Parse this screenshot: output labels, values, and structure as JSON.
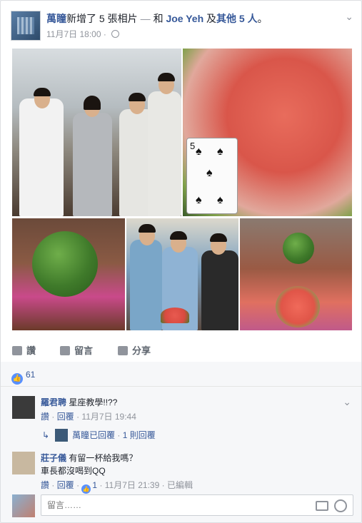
{
  "post": {
    "author": "萬瞳",
    "action": "新增了 5 張相片",
    "sep": "—",
    "with_word": "和",
    "tagged": "Joe Yeh",
    "and_word": "及",
    "others": "其他 5 人",
    "end": "。",
    "date": "11月7日 18:00",
    "date_sep": "·",
    "privacy_icon": "globe-icon"
  },
  "actions": {
    "like_label": "讚",
    "comment_label": "留言",
    "share_label": "分享"
  },
  "reactions": {
    "count": "61",
    "icon": "like-icon"
  },
  "comments": [
    {
      "name": "羅君聘",
      "text": "星座教學!!??",
      "like_label": "讚",
      "dot": "·",
      "reply_label": "回覆",
      "time": "11月7日 19:44",
      "reply_summary": {
        "author": "萬瞳已回覆",
        "count": "1 則回覆"
      }
    },
    {
      "name": "莊子儀",
      "text": "有留一杯給我嗎？",
      "text2": "車長都沒喝到QQ",
      "like_label": "讚",
      "dot": "·",
      "reply_label": "回覆",
      "likes": "1",
      "time": "11月7日 21:39",
      "edited": "已編輯"
    }
  ],
  "composer": {
    "placeholder": "留言……"
  },
  "photo_card": {
    "number": "5"
  },
  "colors": {
    "link": "#365899",
    "meta": "#90949c",
    "like_blue": "#5890ff"
  }
}
